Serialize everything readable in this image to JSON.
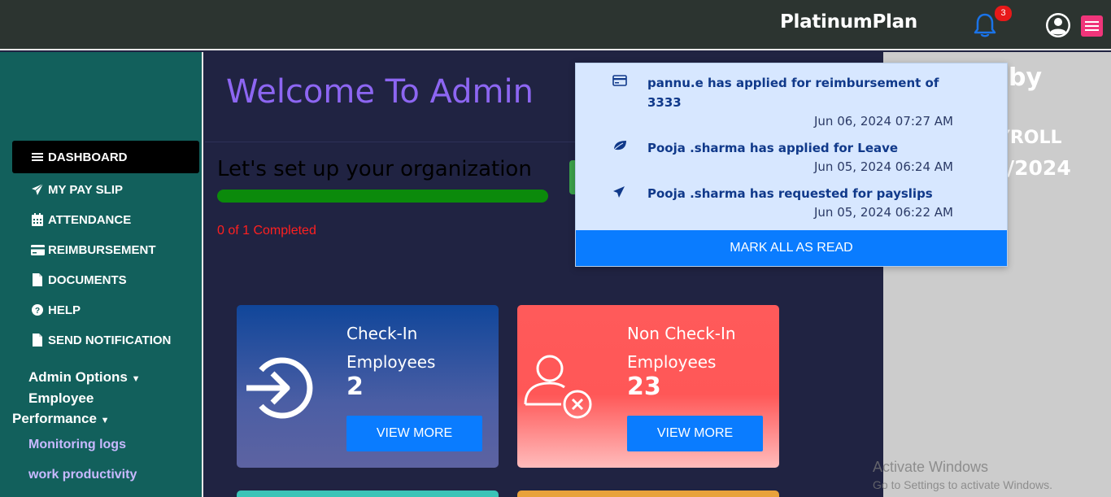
{
  "header": {
    "brand": "PlatinumPlan",
    "notification_count": "3"
  },
  "sidebar": {
    "items": [
      {
        "label": "DASHBOARD",
        "icon": "bars-icon"
      },
      {
        "label": "MY PAY SLIP",
        "icon": "paper-plane-icon"
      },
      {
        "label": "ATTENDANCE",
        "icon": "calendar-icon"
      },
      {
        "label": "REIMBURSEMENT",
        "icon": "credit-card-icon"
      },
      {
        "label": "DOCUMENTS",
        "icon": "file-icon"
      },
      {
        "label": "HELP",
        "icon": "question-circle-icon"
      },
      {
        "label": "SEND NOTIFICATION",
        "icon": "file-icon"
      }
    ],
    "admin_options": "Admin Options",
    "employee_performance_line1": "Employee",
    "employee_performance_line2": "Performance",
    "sub_links": [
      "Monitoring logs",
      "work productivity"
    ]
  },
  "main": {
    "welcome": "Welcome To Admin",
    "setup_title": "Let's set up your organization",
    "completed": "0 of 1 Completed",
    "setup_progress": 1.0,
    "cards": [
      {
        "title_line1": "Check-In",
        "title_line2": "Employees",
        "count": "2",
        "button": "VIEW MORE"
      },
      {
        "title_line1": "Non Check-In",
        "title_line2": "Employees",
        "count": "23",
        "button": "VIEW MORE"
      }
    ]
  },
  "right_panel": {
    "fragment1": "by",
    "fragment2": "AYROLL",
    "fragment3": "/2024"
  },
  "notifications": {
    "items": [
      {
        "text": "pannu.e has applied for reimbursement of 3333",
        "time": "Jun 06, 2024 07:27 AM",
        "icon": "credit-card-icon"
      },
      {
        "text": "Pooja .sharma has applied for Leave",
        "time": "Jun 05, 2024 06:24 AM",
        "icon": "leaf-icon"
      },
      {
        "text": "Pooja .sharma has requested for payslips",
        "time": "Jun 05, 2024 06:22 AM",
        "icon": "paper-plane-icon"
      }
    ],
    "mark_all": "MARK ALL AS READ"
  },
  "watermark": {
    "line1": "Activate Windows",
    "line2": "Go to Settings to activate Windows."
  }
}
